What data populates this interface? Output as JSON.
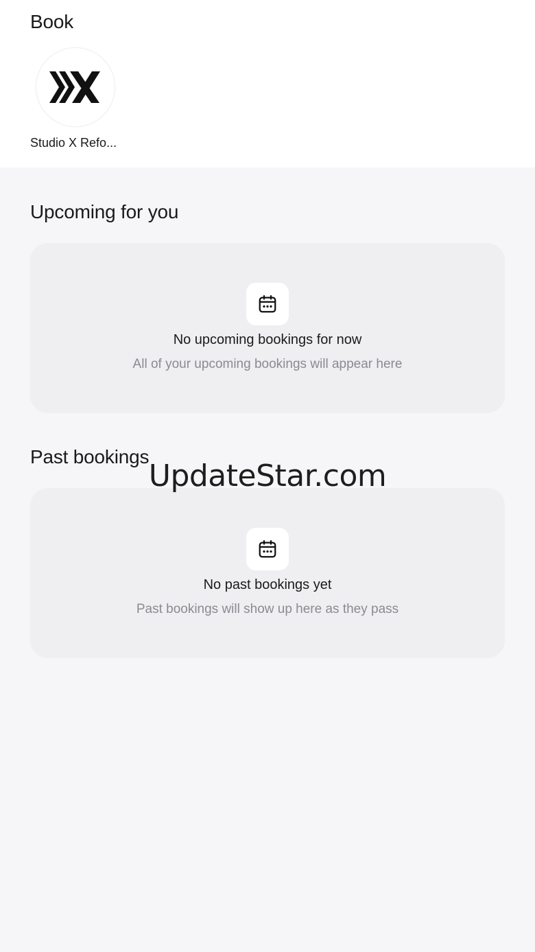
{
  "header": {
    "title": "Book"
  },
  "studios": [
    {
      "name": "Studio X Refo...",
      "logo_icon": "studio-x-logo"
    }
  ],
  "upcoming": {
    "title": "Upcoming for you",
    "empty_icon": "calendar-icon",
    "empty_heading": "No upcoming bookings for now",
    "empty_sub": "All of your upcoming bookings will appear here"
  },
  "past": {
    "title": "Past bookings",
    "empty_icon": "calendar-icon",
    "empty_heading": "No past bookings yet",
    "empty_sub": "Past bookings will show up here as they pass"
  },
  "watermark": "UpdateStar.com",
  "colors": {
    "background": "#f6f6f8",
    "card": "#efeff2",
    "muted_text": "#8a8a90",
    "text": "#1a1a1a"
  }
}
